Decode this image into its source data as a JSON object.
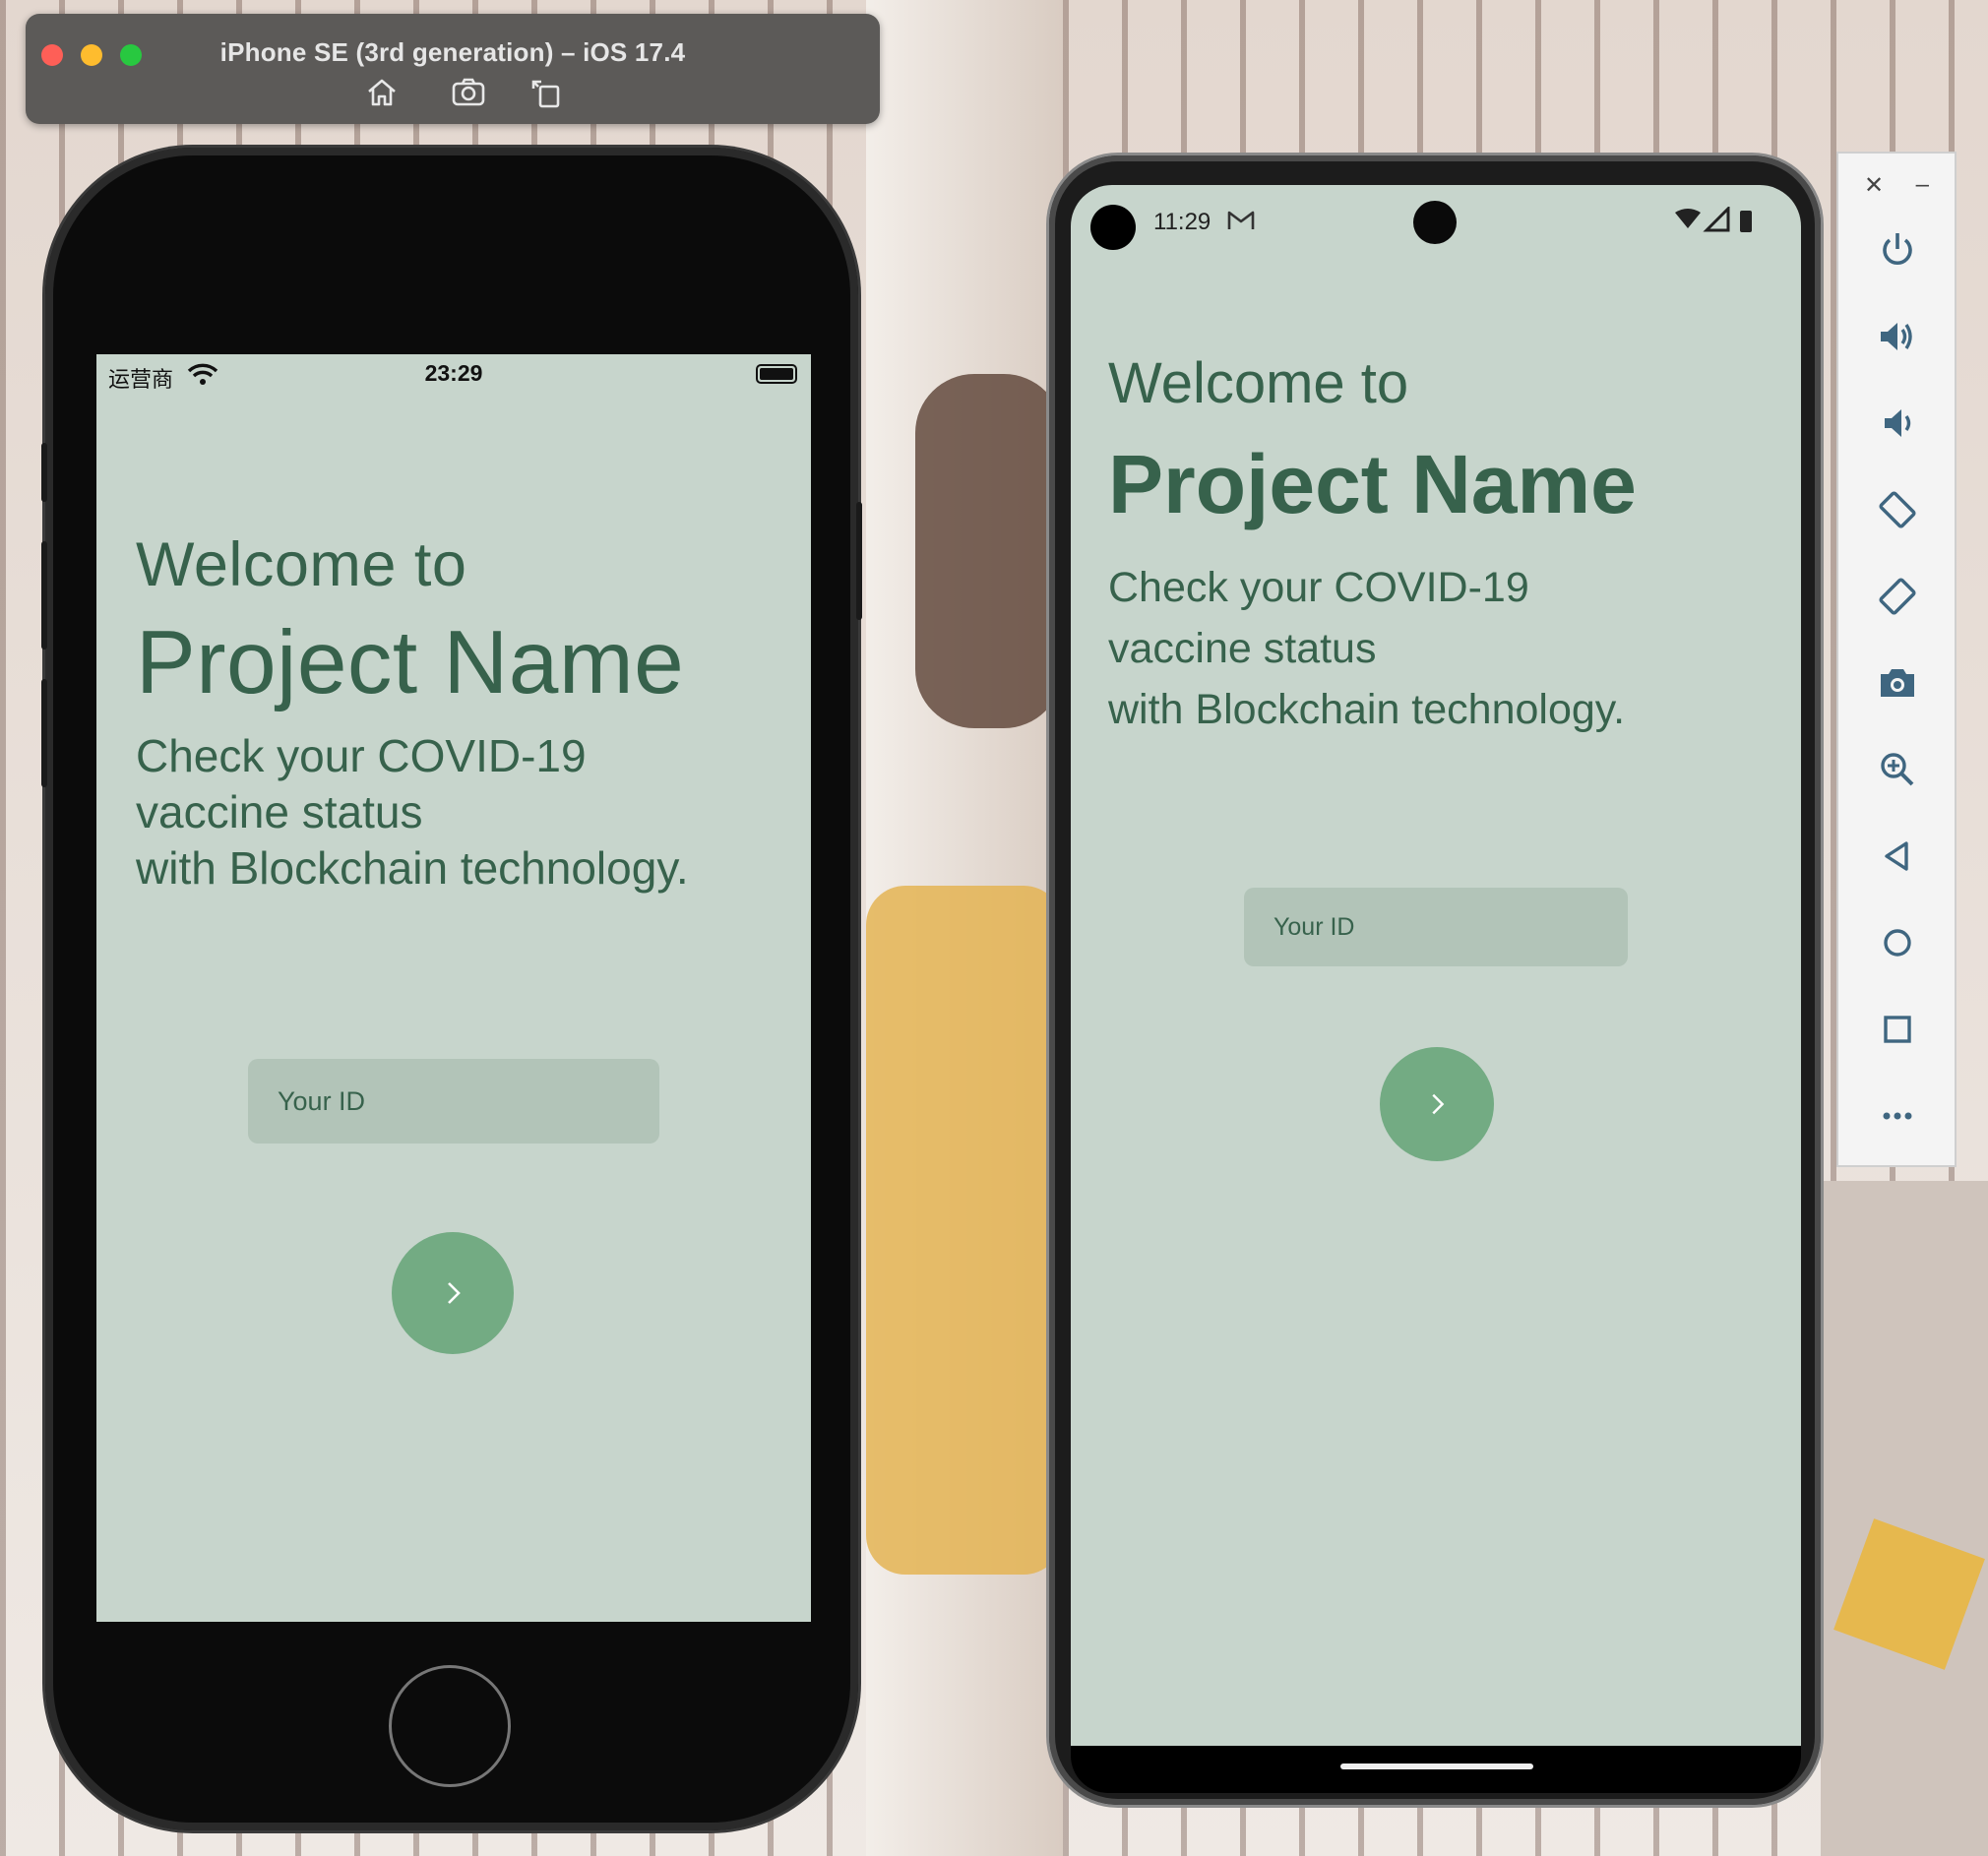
{
  "ios_simulator": {
    "window_title": "iPhone SE (3rd generation) – iOS 17.4",
    "toolbar": [
      "home-icon",
      "screenshot-icon",
      "rotate-icon"
    ],
    "status_bar": {
      "carrier": "运营商",
      "time": "23:29"
    },
    "app": {
      "welcome": "Welcome to",
      "project": "Project Name",
      "desc_lines": [
        "Check your COVID-19",
        "vaccine status",
        "with Blockchain technology."
      ],
      "input_placeholder": "Your ID",
      "submit_icon": "chevron-right-icon"
    }
  },
  "android_emulator": {
    "status_bar": {
      "time": "11:29"
    },
    "app": {
      "welcome": "Welcome to",
      "project": "Project Name",
      "desc_lines": [
        "Check your COVID-19",
        "vaccine status",
        "with Blockchain technology."
      ],
      "input_placeholder": "Your ID",
      "submit_icon": "chevron-right-icon"
    },
    "side_toolbar": [
      "close-icon",
      "minimize-icon",
      "power-icon",
      "volume-up-icon",
      "volume-down-icon",
      "rotate-left-icon",
      "rotate-right-icon",
      "camera-icon",
      "zoom-icon",
      "back-icon",
      "home-icon",
      "overview-icon",
      "more-icon"
    ]
  },
  "colors": {
    "app_background": "#c7d5cc",
    "text": "#37624c",
    "input_background": "#b2c4b8",
    "button": "#73ab83"
  }
}
